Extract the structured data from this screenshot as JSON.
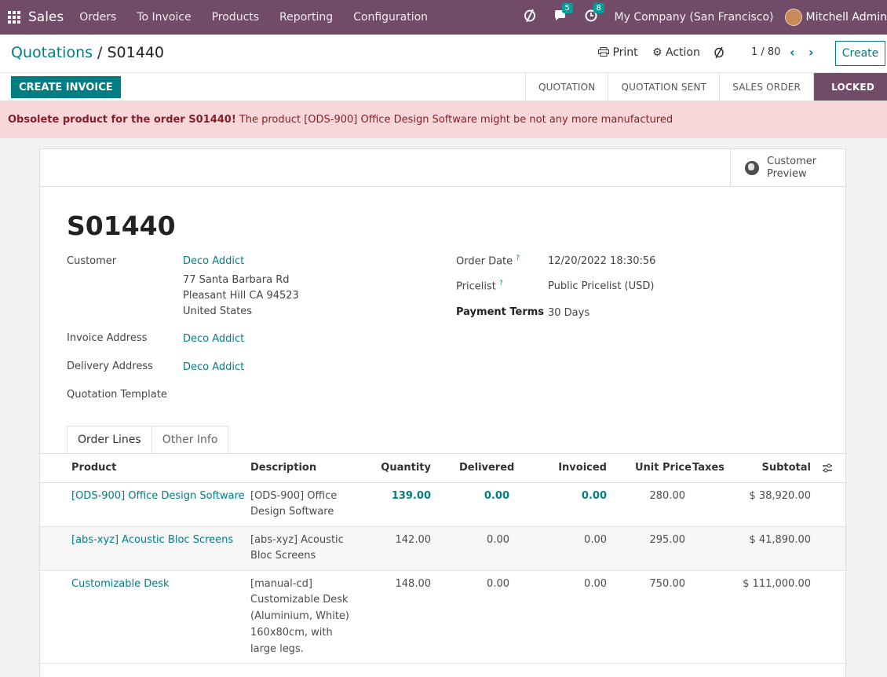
{
  "nav": {
    "app_name": "Sales",
    "menu": [
      "Orders",
      "To Invoice",
      "Products",
      "Reporting",
      "Configuration"
    ],
    "chat_count": "5",
    "activity_count": "8",
    "company": "My Company (San Francisco)",
    "user": "Mitchell Admin"
  },
  "control": {
    "breadcrumb_parent": "Quotations",
    "breadcrumb_sep": " / ",
    "breadcrumb_current": "S01440",
    "print_label": "Print",
    "action_label": "Action",
    "pager": "1 / 80",
    "create_label": "Create"
  },
  "status": {
    "invoice_button": "CREATE INVOICE",
    "stages": [
      "QUOTATION",
      "QUOTATION SENT",
      "SALES ORDER",
      "LOCKED"
    ],
    "active_stage": "LOCKED"
  },
  "warning": {
    "bold": "Obsolete product for the order S01440!",
    "text": "The product [ODS-900] Office Design Software might be not any more manufactured"
  },
  "form": {
    "preview_label": "Customer Preview",
    "title": "S01440",
    "customer_label": "Customer",
    "customer_name": "Deco Addict",
    "customer_address1": "77 Santa Barbara Rd",
    "customer_address2": "Pleasant Hill CA 94523",
    "customer_address3": "United States",
    "invoice_address_label": "Invoice Address",
    "invoice_address": "Deco Addict",
    "delivery_address_label": "Delivery Address",
    "delivery_address": "Deco Addict",
    "template_label": "Quotation Template",
    "order_date_label": "Order Date",
    "order_date": "12/20/2022 18:30:56",
    "pricelist_label": "Pricelist",
    "pricelist": "Public Pricelist (USD)",
    "payment_terms_label": "Payment Terms",
    "payment_terms": "30 Days",
    "help_mark": "?"
  },
  "tabs": [
    "Order Lines",
    "Other Info"
  ],
  "table": {
    "headers": [
      "Product",
      "Description",
      "Quantity",
      "Delivered",
      "Invoiced",
      "Unit Price",
      "Taxes",
      "Subtotal"
    ],
    "rows": [
      {
        "product": "[ODS-900] Office Design Software",
        "description": [
          "[ODS-900] Office",
          "Design Software"
        ],
        "quantity": "139.00",
        "delivered": "0.00",
        "invoiced": "0.00",
        "unit_price": "280.00",
        "subtotal": "$ 38,920.00"
      },
      {
        "product": "[abs-xyz] Acoustic Bloc Screens",
        "description": [
          "[abs-xyz] Acoustic",
          "Bloc Screens"
        ],
        "quantity": "142.00",
        "delivered": "0.00",
        "invoiced": "0.00",
        "unit_price": "295.00",
        "subtotal": "$ 41,890.00"
      },
      {
        "product": "Customizable Desk",
        "description": [
          "[manual-cd]",
          "Customizable Desk",
          "(Aluminium, White)",
          "160x80cm, with",
          "large legs."
        ],
        "quantity": "148.00",
        "delivered": "0.00",
        "invoiced": "0.00",
        "unit_price": "750.00",
        "subtotal": "$ 111,000.00"
      }
    ]
  },
  "colors": {
    "brand": "#714b67",
    "accent": "#017e84",
    "warning_bg": "#f8d7da"
  }
}
